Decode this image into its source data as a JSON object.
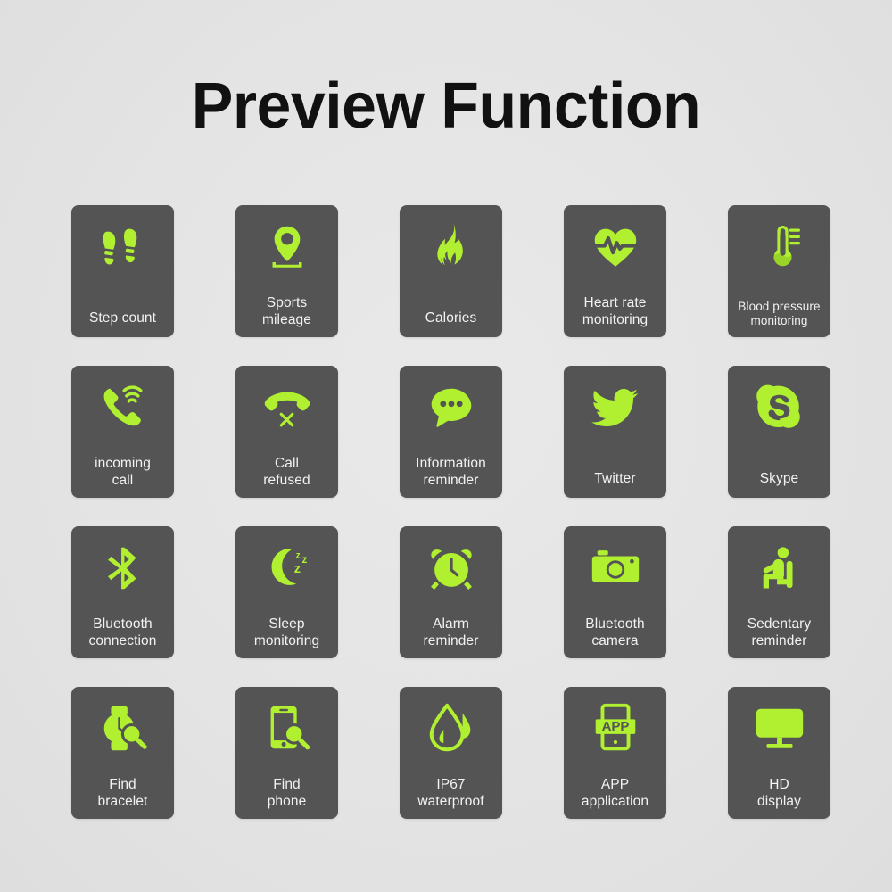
{
  "page": {
    "title": "Preview Function",
    "background_color": "#e4e4e4",
    "card_color": "#545454",
    "icon_color": "#b0f030",
    "label_color": "#f2f2f2"
  },
  "grid": {
    "columns": 5,
    "rows": 4,
    "cards": [
      {
        "icon": "footprints-icon",
        "label": "Step count",
        "lines": 1,
        "size": "normal"
      },
      {
        "icon": "map-pin-icon",
        "label": "Sports\nmileage",
        "lines": 2,
        "size": "normal"
      },
      {
        "icon": "flame-icon",
        "label": "Calories",
        "lines": 1,
        "size": "normal"
      },
      {
        "icon": "heart-pulse-icon",
        "label": "Heart rate\nmonitoring",
        "lines": 2,
        "size": "normal"
      },
      {
        "icon": "thermometer-icon",
        "label": "Blood pressure\nmonitoring",
        "lines": 2,
        "size": "small"
      },
      {
        "icon": "phone-incoming-icon",
        "label": "incoming\ncall",
        "lines": 2,
        "size": "normal"
      },
      {
        "icon": "phone-refused-icon",
        "label": "Call\nrefused",
        "lines": 2,
        "size": "normal"
      },
      {
        "icon": "speech-bubble-icon",
        "label": "Information\nreminder",
        "lines": 2,
        "size": "normal"
      },
      {
        "icon": "twitter-bird-icon",
        "label": "Twitter",
        "lines": 1,
        "size": "normal"
      },
      {
        "icon": "skype-icon",
        "label": "Skype",
        "lines": 1,
        "size": "normal"
      },
      {
        "icon": "bluetooth-icon",
        "label": "Bluetooth\nconnection",
        "lines": 2,
        "size": "normal"
      },
      {
        "icon": "moon-sleep-icon",
        "label": "Sleep\nmonitoring",
        "lines": 2,
        "size": "normal"
      },
      {
        "icon": "alarm-clock-icon",
        "label": "Alarm\nreminder",
        "lines": 2,
        "size": "normal"
      },
      {
        "icon": "camera-icon",
        "label": "Bluetooth\ncamera",
        "lines": 2,
        "size": "normal"
      },
      {
        "icon": "sitting-person-icon",
        "label": "Sedentary\nreminder",
        "lines": 2,
        "size": "normal"
      },
      {
        "icon": "watch-search-icon",
        "label": "Find\nbracelet",
        "lines": 2,
        "size": "normal"
      },
      {
        "icon": "phone-search-icon",
        "label": "Find\nphone",
        "lines": 2,
        "size": "normal"
      },
      {
        "icon": "water-drop-icon",
        "label": "IP67\nwaterproof",
        "lines": 2,
        "size": "normal"
      },
      {
        "icon": "app-tablet-icon",
        "label": "APP\napplication",
        "lines": 2,
        "size": "normal",
        "icon_text": "APP"
      },
      {
        "icon": "monitor-icon",
        "label": "HD\ndisplay",
        "lines": 2,
        "size": "normal"
      }
    ]
  }
}
